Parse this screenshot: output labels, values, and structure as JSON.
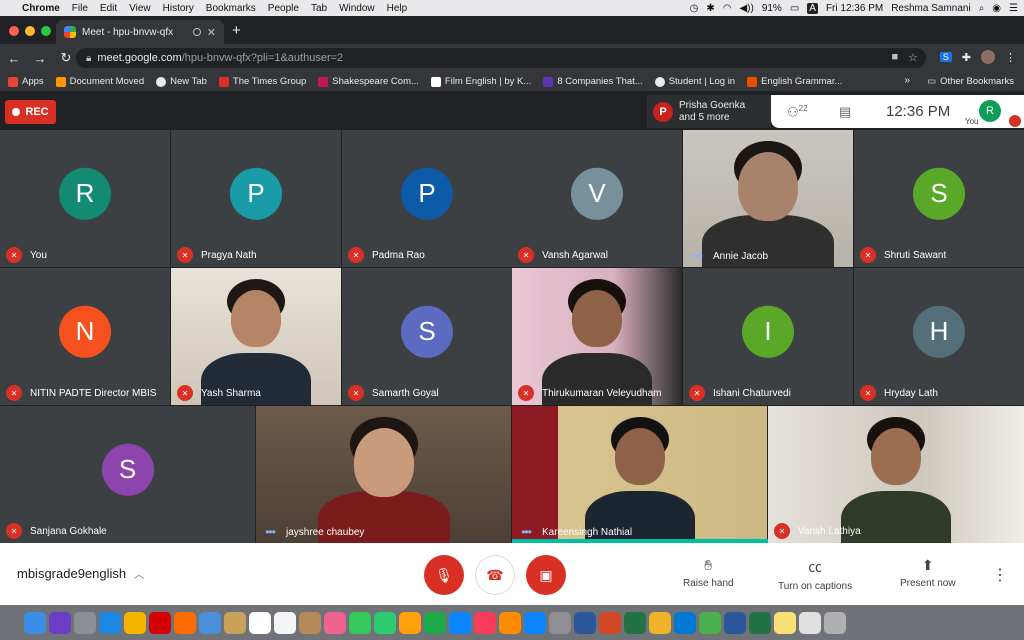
{
  "menubar": {
    "app": "Chrome",
    "items": [
      "File",
      "Edit",
      "View",
      "History",
      "Bookmarks",
      "People",
      "Tab",
      "Window",
      "Help"
    ],
    "battery": "91%",
    "clock": "Fri 12:36 PM",
    "user": "Reshma Samnani",
    "input_source": "A"
  },
  "browser": {
    "tab_title": "Meet - hpu-bnvw-qfx",
    "url_host": "meet.google.com",
    "url_path": "/hpu-bnvw-qfx?pli=1&authuser=2"
  },
  "bookmarks": {
    "items": [
      {
        "label": "Apps",
        "color": "#ea4335"
      },
      {
        "label": "Document Moved",
        "color": "#ff9800"
      },
      {
        "label": "New Tab",
        "color": "#e8eaed"
      },
      {
        "label": "The Times Group",
        "color": "#d93025"
      },
      {
        "label": "Shakespeare Com...",
        "color": "#c2185b"
      },
      {
        "label": "Film English | by K...",
        "color": "#ffffff"
      },
      {
        "label": "8 Companies That...",
        "color": "#5e35b1"
      },
      {
        "label": "Student | Log in",
        "color": "#e8eaed"
      },
      {
        "label": "English Grammar...",
        "color": "#e65100"
      }
    ],
    "other": "Other Bookmarks"
  },
  "meet": {
    "rec_label": "REC",
    "notification_avatar": "P",
    "notification_line1": "Prisha Goenka",
    "notification_line2": "and 5 more",
    "people_count": "22",
    "time": "12:36 PM",
    "self_initial": "R",
    "self_label": "You",
    "meeting_name": "mbisgrade9english",
    "raise_hand": "Raise hand",
    "captions": "Turn on captions",
    "present": "Present now"
  },
  "participants": [
    {
      "name": "You",
      "initial": "R",
      "color": "#138a72",
      "muted": true
    },
    {
      "name": "Pragya Nath",
      "initial": "P",
      "color": "#1a9ba8",
      "muted": true
    },
    {
      "name": "Padma Rao",
      "initial": "P",
      "color": "#0d5ba6",
      "muted": true
    },
    {
      "name": "Vansh Agarwal",
      "initial": "V",
      "color": "#78909c",
      "muted": true
    },
    {
      "name": "Annie Jacob",
      "initial": "",
      "color": "",
      "muted": false
    },
    {
      "name": "Shruti Sawant",
      "initial": "S",
      "color": "#5aa828",
      "muted": true
    },
    {
      "name": "NITIN PADTE Director MBIS",
      "initial": "N",
      "color": "#f4511e",
      "muted": true
    },
    {
      "name": "Yash Sharma",
      "initial": "",
      "color": "",
      "muted": true
    },
    {
      "name": "Samarth Goyal",
      "initial": "S",
      "color": "#5c6bc0",
      "muted": true
    },
    {
      "name": "Thirukumaran Veleyudham",
      "initial": "",
      "color": "",
      "muted": true
    },
    {
      "name": "Ishani Chaturvedi",
      "initial": "I",
      "color": "#5aa828",
      "muted": true
    },
    {
      "name": "Hryday Lath",
      "initial": "H",
      "color": "#546e7a",
      "muted": true
    },
    {
      "name": "Sanjana Gokhale",
      "initial": "S",
      "color": "#8e44ad",
      "muted": true
    },
    {
      "name": "jayshree chaubey",
      "initial": "",
      "color": "",
      "muted": false
    },
    {
      "name": "Kareensingh Nathial",
      "initial": "",
      "color": "",
      "muted": false
    },
    {
      "name": "Vansh Lathiya",
      "initial": "",
      "color": "",
      "muted": true
    }
  ]
}
